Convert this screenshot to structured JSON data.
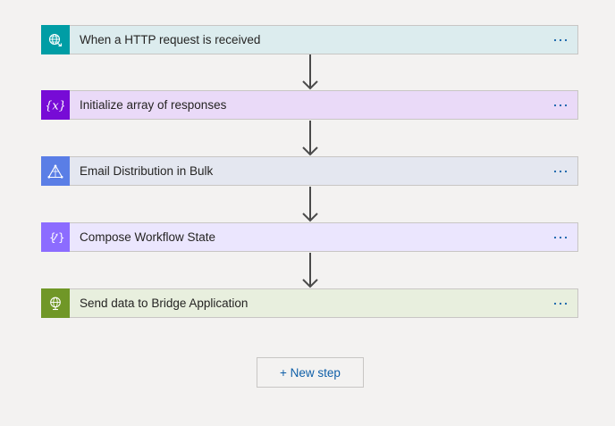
{
  "steps": [
    {
      "label": "When a HTTP request is received",
      "icon": "globe-request-icon",
      "icon_color": "#009da5",
      "bg_color": "#dcecee"
    },
    {
      "label": "Initialize array of responses",
      "icon": "variable-icon",
      "icon_color": "#770bd6",
      "bg_color": "#eadaf8"
    },
    {
      "label": "Email Distribution in Bulk",
      "icon": "logic-app-icon",
      "icon_color": "#5a7ee6",
      "bg_color": "#e4e7f0"
    },
    {
      "label": "Compose Workflow State",
      "icon": "compose-icon",
      "icon_color": "#8c6cff",
      "bg_color": "#ebe6fe"
    },
    {
      "label": "Send data to Bridge Application",
      "icon": "http-globe-icon",
      "icon_color": "#709727",
      "bg_color": "#e8efde"
    }
  ],
  "menu_glyph": "⋯",
  "new_step_label": "+ New step",
  "colors": {
    "canvas": "#f3f2f1",
    "border": "#c8c6c4",
    "link": "#0f5fa8",
    "arrow": "#4a4a4a"
  }
}
